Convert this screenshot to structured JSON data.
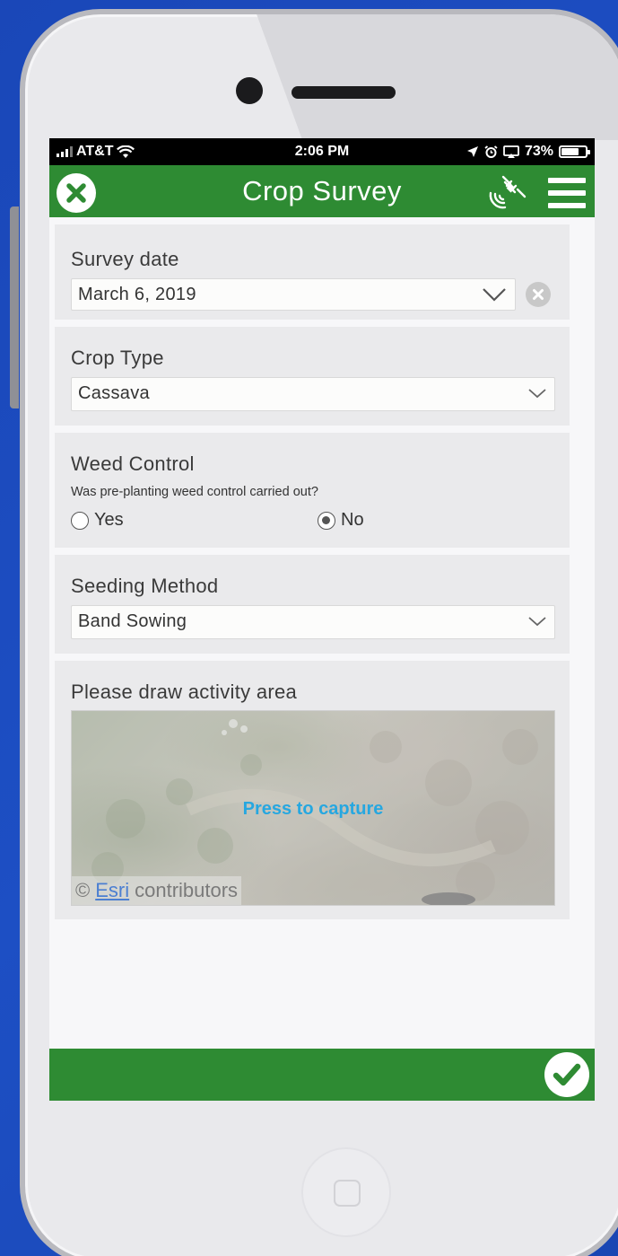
{
  "status_bar": {
    "carrier": "AT&T",
    "time": "2:06 PM",
    "battery_percent": "73%",
    "battery_level": 0.73
  },
  "header": {
    "title": "Crop Survey"
  },
  "form": {
    "survey_date": {
      "label": "Survey date",
      "value": "March 6, 2019"
    },
    "crop_type": {
      "label": "Crop Type",
      "value": "Cassava"
    },
    "weed_control": {
      "label": "Weed Control",
      "hint": "Was pre-planting weed control carried out?",
      "options": [
        "Yes",
        "No"
      ],
      "selected": "No"
    },
    "seeding_method": {
      "label": "Seeding Method",
      "value": "Band Sowing"
    },
    "activity_area": {
      "label": "Please draw activity area",
      "capture_text": "Press to capture",
      "attribution_prefix": "©",
      "attribution_link": "Esri",
      "attribution_suffix": "contributors"
    }
  },
  "colors": {
    "accent_green": "#2e8b33",
    "capture_blue": "#26a7e0",
    "background": "#1d4fc4"
  },
  "icons": {
    "close": "close-icon",
    "gps": "satellite-icon",
    "menu": "menu-icon",
    "submit": "checkmark-icon",
    "dropdown": "chevron-down-icon",
    "clear": "clear-icon"
  }
}
